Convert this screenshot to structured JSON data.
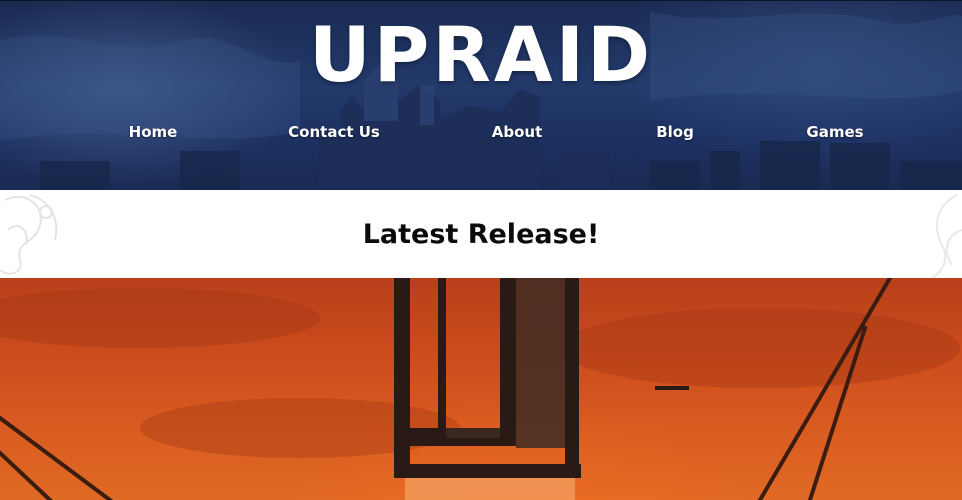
{
  "site": {
    "logo": "UPRAID"
  },
  "nav": {
    "items": [
      {
        "label": "Home"
      },
      {
        "label": "Contact Us"
      },
      {
        "label": "About"
      },
      {
        "label": "Blog"
      },
      {
        "label": "Games"
      }
    ]
  },
  "release": {
    "heading": "Latest Release!"
  },
  "colors": {
    "hero_blue": "#22396a",
    "band_white": "#ffffff",
    "feature_orange": "#d85a20",
    "text_white": "#ffffff",
    "text_dark": "#0b0b0b"
  }
}
